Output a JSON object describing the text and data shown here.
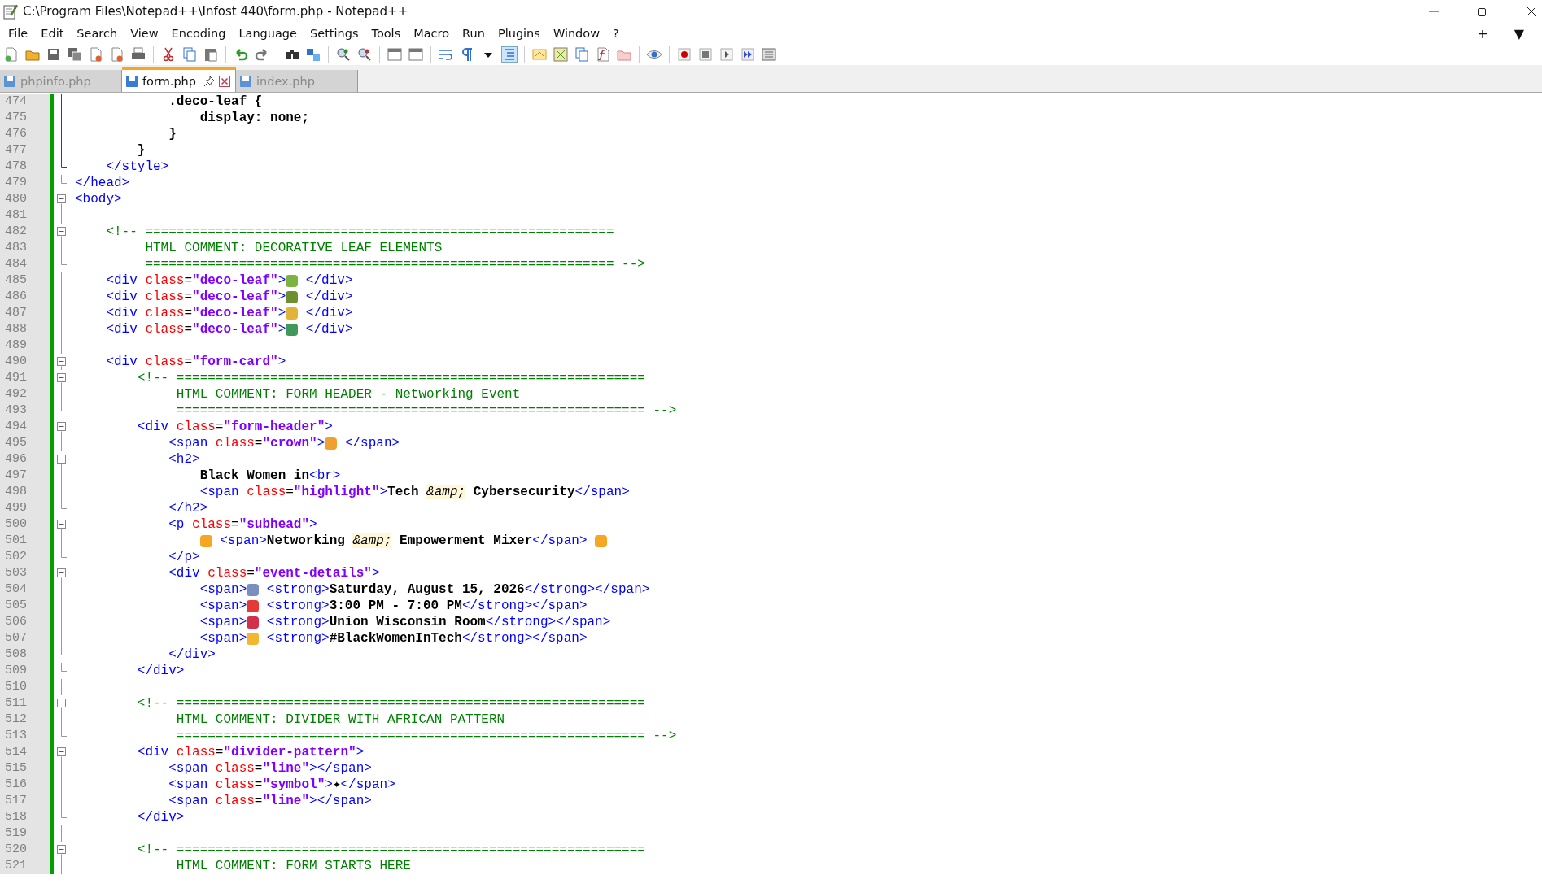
{
  "window": {
    "title": "C:\\Program Files\\Notepad++\\Infost 440\\form.php - Notepad++"
  },
  "menu": [
    "File",
    "Edit",
    "Search",
    "View",
    "Encoding",
    "Language",
    "Settings",
    "Tools",
    "Macro",
    "Run",
    "Plugins",
    "Window",
    "?"
  ],
  "menu_extras": [
    "+",
    "▼"
  ],
  "tabs": [
    {
      "label": "phpinfo.php",
      "selected": false
    },
    {
      "label": "form.php",
      "selected": true
    },
    {
      "label": "index.php",
      "selected": false
    }
  ],
  "lines": [
    {
      "n": "474",
      "fold_start": false,
      "fold_end": false,
      "current_block": true,
      "tokens": [
        {
          "kind": "text",
          "s": "            .deco-leaf {"
        }
      ]
    },
    {
      "n": "475",
      "fold_start": false,
      "fold_end": false,
      "current_block": true,
      "tokens": [
        {
          "kind": "text",
          "s": "                display: none;"
        }
      ]
    },
    {
      "n": "476",
      "fold_start": false,
      "fold_end": false,
      "current_block": true,
      "tokens": [
        {
          "kind": "text",
          "s": "            }"
        }
      ]
    },
    {
      "n": "477",
      "fold_start": false,
      "fold_end": false,
      "current_block": true,
      "tokens": [
        {
          "kind": "text",
          "s": "        }"
        }
      ]
    },
    {
      "n": "478",
      "fold_start": false,
      "fold_end": true,
      "current_block": true,
      "tokens": [
        {
          "kind": "tag",
          "s": "    </style>"
        }
      ]
    },
    {
      "n": "479",
      "fold_start": false,
      "fold_end": true,
      "current_block": false,
      "tokens": [
        {
          "kind": "tag",
          "s": "</head>"
        }
      ]
    },
    {
      "n": "480",
      "fold_start": true,
      "fold_end": false,
      "current_block": false,
      "tokens": [
        {
          "kind": "tag",
          "s": "<body>"
        }
      ]
    },
    {
      "n": "481",
      "fold_start": false,
      "fold_end": false,
      "current_block": false
    },
    {
      "n": "482",
      "fold_start": true,
      "fold_end": false,
      "current_block": false,
      "tokens": [
        {
          "kind": "comment",
          "s": "    <!-- ============================================================"
        }
      ]
    },
    {
      "n": "483",
      "fold_start": false,
      "fold_end": false,
      "current_block": false,
      "tokens": [
        {
          "kind": "comment",
          "s": "         HTML COMMENT: DECORATIVE LEAF ELEMENTS"
        }
      ]
    },
    {
      "n": "484",
      "fold_start": false,
      "fold_end": true,
      "current_block": false,
      "tokens": [
        {
          "kind": "comment",
          "s": "         ============================================================ -->"
        }
      ]
    },
    {
      "n": "485",
      "fold_start": false,
      "fold_end": false,
      "current_block": false,
      "tokens": [
        {
          "kind": "tag",
          "s": "    <div"
        },
        {
          "kind": "attr",
          "s": " class"
        },
        {
          "kind": "op",
          "s": "="
        },
        {
          "kind": "str",
          "s": "\"deco-leaf\""
        },
        {
          "kind": "tag",
          "s": ">"
        },
        {
          "kind": "emoji",
          "color": "#7cb342"
        },
        {
          "kind": "tag",
          "s": " </div>"
        }
      ]
    },
    {
      "n": "486",
      "fold_start": false,
      "fold_end": false,
      "current_block": false,
      "tokens": [
        {
          "kind": "tag",
          "s": "    <div"
        },
        {
          "kind": "attr",
          "s": " class"
        },
        {
          "kind": "op",
          "s": "="
        },
        {
          "kind": "str",
          "s": "\"deco-leaf\""
        },
        {
          "kind": "tag",
          "s": ">"
        },
        {
          "kind": "emoji",
          "color": "#6d8f2f"
        },
        {
          "kind": "tag",
          "s": " </div>"
        }
      ]
    },
    {
      "n": "487",
      "fold_start": false,
      "fold_end": false,
      "current_block": false,
      "tokens": [
        {
          "kind": "tag",
          "s": "    <div"
        },
        {
          "kind": "attr",
          "s": " class"
        },
        {
          "kind": "op",
          "s": "="
        },
        {
          "kind": "str",
          "s": "\"deco-leaf\""
        },
        {
          "kind": "tag",
          "s": ">"
        },
        {
          "kind": "emoji",
          "color": "#e0b43a"
        },
        {
          "kind": "tag",
          "s": " </div>"
        }
      ]
    },
    {
      "n": "488",
      "fold_start": false,
      "fold_end": false,
      "current_block": false,
      "tokens": [
        {
          "kind": "tag",
          "s": "    <div"
        },
        {
          "kind": "attr",
          "s": " class"
        },
        {
          "kind": "op",
          "s": "="
        },
        {
          "kind": "str",
          "s": "\"deco-leaf\""
        },
        {
          "kind": "tag",
          "s": ">"
        },
        {
          "kind": "emoji",
          "color": "#3f9a5a"
        },
        {
          "kind": "tag",
          "s": " </div>"
        }
      ]
    },
    {
      "n": "489",
      "fold_start": false,
      "fold_end": false,
      "current_block": false
    },
    {
      "n": "490",
      "fold_start": true,
      "fold_end": false,
      "current_block": false,
      "tokens": [
        {
          "kind": "tag",
          "s": "    <div"
        },
        {
          "kind": "attr",
          "s": " class"
        },
        {
          "kind": "op",
          "s": "="
        },
        {
          "kind": "str",
          "s": "\"form-card\""
        },
        {
          "kind": "tag",
          "s": ">"
        }
      ]
    },
    {
      "n": "491",
      "fold_start": true,
      "fold_end": false,
      "current_block": false,
      "tokens": [
        {
          "kind": "comment",
          "s": "        <!-- ============================================================"
        }
      ]
    },
    {
      "n": "492",
      "fold_start": false,
      "fold_end": false,
      "current_block": false,
      "tokens": [
        {
          "kind": "comment",
          "s": "             HTML COMMENT: FORM HEADER - Networking Event"
        }
      ]
    },
    {
      "n": "493",
      "fold_start": false,
      "fold_end": true,
      "current_block": false,
      "tokens": [
        {
          "kind": "comment",
          "s": "             ============================================================ -->"
        }
      ]
    },
    {
      "n": "494",
      "fold_start": true,
      "fold_end": false,
      "current_block": false,
      "tokens": [
        {
          "kind": "tag",
          "s": "        <div"
        },
        {
          "kind": "attr",
          "s": " class"
        },
        {
          "kind": "op",
          "s": "="
        },
        {
          "kind": "str",
          "s": "\"form-header\""
        },
        {
          "kind": "tag",
          "s": ">"
        }
      ]
    },
    {
      "n": "495",
      "fold_start": false,
      "fold_end": false,
      "current_block": false,
      "tokens": [
        {
          "kind": "tag",
          "s": "            <span"
        },
        {
          "kind": "attr",
          "s": " class"
        },
        {
          "kind": "op",
          "s": "="
        },
        {
          "kind": "str",
          "s": "\"crown\""
        },
        {
          "kind": "tag",
          "s": ">"
        },
        {
          "kind": "emoji",
          "color": "#f0a030"
        },
        {
          "kind": "tag",
          "s": " </span>"
        }
      ]
    },
    {
      "n": "496",
      "fold_start": true,
      "fold_end": false,
      "current_block": false,
      "tokens": [
        {
          "kind": "tag",
          "s": "            <h2>"
        }
      ]
    },
    {
      "n": "497",
      "fold_start": false,
      "fold_end": false,
      "current_block": false,
      "tokens": [
        {
          "kind": "text",
          "s": "                Black Women in"
        },
        {
          "kind": "tag",
          "s": "<br>"
        }
      ]
    },
    {
      "n": "498",
      "fold_start": false,
      "fold_end": false,
      "current_block": false,
      "tokens": [
        {
          "kind": "tag",
          "s": "                <span"
        },
        {
          "kind": "attr",
          "s": " class"
        },
        {
          "kind": "op",
          "s": "="
        },
        {
          "kind": "str",
          "s": "\"highlight\""
        },
        {
          "kind": "tag",
          "s": ">"
        },
        {
          "kind": "text",
          "s": "Tech "
        },
        {
          "kind": "entity",
          "s": "&amp;"
        },
        {
          "kind": "text",
          "s": " Cybersecurity"
        },
        {
          "kind": "tag",
          "s": "</span>"
        }
      ]
    },
    {
      "n": "499",
      "fold_start": false,
      "fold_end": true,
      "current_block": false,
      "tokens": [
        {
          "kind": "tag",
          "s": "            </h2>"
        }
      ]
    },
    {
      "n": "500",
      "fold_start": true,
      "fold_end": false,
      "current_block": false,
      "tokens": [
        {
          "kind": "tag",
          "s": "            <p"
        },
        {
          "kind": "attr",
          "s": " class"
        },
        {
          "kind": "op",
          "s": "="
        },
        {
          "kind": "str",
          "s": "\"subhead\""
        },
        {
          "kind": "tag",
          "s": ">"
        }
      ]
    },
    {
      "n": "501",
      "fold_start": false,
      "fold_end": false,
      "current_block": false,
      "tokens": [
        {
          "kind": "emoji",
          "color": "#f5a623"
        },
        {
          "kind": "tag",
          "s": " <span>"
        },
        {
          "kind": "text",
          "s": "Networking "
        },
        {
          "kind": "entity",
          "s": "&amp;"
        },
        {
          "kind": "text",
          "s": " Empowerment Mixer"
        },
        {
          "kind": "tag",
          "s": "</span> "
        },
        {
          "kind": "emoji",
          "color": "#f5a623"
        }
      ]
    },
    {
      "n": "502",
      "fold_start": false,
      "fold_end": true,
      "current_block": false,
      "tokens": [
        {
          "kind": "tag",
          "s": "            </p>"
        }
      ]
    },
    {
      "n": "503",
      "fold_start": true,
      "fold_end": false,
      "current_block": false,
      "tokens": [
        {
          "kind": "tag",
          "s": "            <div"
        },
        {
          "kind": "attr",
          "s": " class"
        },
        {
          "kind": "op",
          "s": "="
        },
        {
          "kind": "str",
          "s": "\"event-details\""
        },
        {
          "kind": "tag",
          "s": ">"
        }
      ]
    },
    {
      "n": "504",
      "fold_start": false,
      "fold_end": false,
      "current_block": false,
      "tokens": [
        {
          "kind": "tag",
          "s": "                <span>"
        },
        {
          "kind": "emoji",
          "color": "#7a8fc0"
        },
        {
          "kind": "tag",
          "s": " <strong>"
        },
        {
          "kind": "text",
          "s": "Saturday, August 15, 2026"
        },
        {
          "kind": "tag",
          "s": "</strong></span>"
        }
      ]
    },
    {
      "n": "505",
      "fold_start": false,
      "fold_end": false,
      "current_block": false,
      "tokens": [
        {
          "kind": "tag",
          "s": "                <span>"
        },
        {
          "kind": "emoji",
          "color": "#e53935"
        },
        {
          "kind": "tag",
          "s": " <strong>"
        },
        {
          "kind": "text",
          "s": "3:00 PM - 7:00 PM"
        },
        {
          "kind": "tag",
          "s": "</strong></span>"
        }
      ]
    },
    {
      "n": "506",
      "fold_start": false,
      "fold_end": false,
      "current_block": false,
      "tokens": [
        {
          "kind": "tag",
          "s": "                <span>"
        },
        {
          "kind": "emoji",
          "color": "#d32f4a"
        },
        {
          "kind": "tag",
          "s": " <strong>"
        },
        {
          "kind": "text",
          "s": "Union Wisconsin Room"
        },
        {
          "kind": "tag",
          "s": "</strong></span>"
        }
      ]
    },
    {
      "n": "507",
      "fold_start": false,
      "fold_end": false,
      "current_block": false,
      "tokens": [
        {
          "kind": "tag",
          "s": "                <span>"
        },
        {
          "kind": "emoji",
          "color": "#f2b631"
        },
        {
          "kind": "tag",
          "s": " <strong>"
        },
        {
          "kind": "text",
          "s": "#BlackWomenInTech"
        },
        {
          "kind": "tag",
          "s": "</strong></span>"
        }
      ]
    },
    {
      "n": "508",
      "fold_start": false,
      "fold_end": true,
      "current_block": false,
      "tokens": [
        {
          "kind": "tag",
          "s": "            </div>"
        }
      ]
    },
    {
      "n": "509",
      "fold_start": false,
      "fold_end": true,
      "current_block": false,
      "tokens": [
        {
          "kind": "tag",
          "s": "        </div>"
        }
      ]
    },
    {
      "n": "510",
      "fold_start": false,
      "fold_end": false,
      "current_block": false
    },
    {
      "n": "511",
      "fold_start": true,
      "fold_end": false,
      "current_block": false,
      "tokens": [
        {
          "kind": "comment",
          "s": "        <!-- ============================================================"
        }
      ]
    },
    {
      "n": "512",
      "fold_start": false,
      "fold_end": false,
      "current_block": false,
      "tokens": [
        {
          "kind": "comment",
          "s": "             HTML COMMENT: DIVIDER WITH AFRICAN PATTERN"
        }
      ]
    },
    {
      "n": "513",
      "fold_start": false,
      "fold_end": true,
      "current_block": false,
      "tokens": [
        {
          "kind": "comment",
          "s": "             ============================================================ -->"
        }
      ]
    },
    {
      "n": "514",
      "fold_start": true,
      "fold_end": false,
      "current_block": false,
      "tokens": [
        {
          "kind": "tag",
          "s": "        <div"
        },
        {
          "kind": "attr",
          "s": " class"
        },
        {
          "kind": "op",
          "s": "="
        },
        {
          "kind": "str",
          "s": "\"divider-pattern\""
        },
        {
          "kind": "tag",
          "s": ">"
        }
      ]
    },
    {
      "n": "515",
      "fold_start": false,
      "fold_end": false,
      "current_block": false,
      "tokens": [
        {
          "kind": "tag",
          "s": "            <span"
        },
        {
          "kind": "attr",
          "s": " class"
        },
        {
          "kind": "op",
          "s": "="
        },
        {
          "kind": "str",
          "s": "\"line\""
        },
        {
          "kind": "tag",
          "s": "></span>"
        }
      ]
    },
    {
      "n": "516",
      "fold_start": false,
      "fold_end": false,
      "current_block": false,
      "tokens": [
        {
          "kind": "tag",
          "s": "            <span"
        },
        {
          "kind": "attr",
          "s": " class"
        },
        {
          "kind": "op",
          "s": "="
        },
        {
          "kind": "str",
          "s": "\"symbol\""
        },
        {
          "kind": "tag",
          "s": ">"
        },
        {
          "kind": "text",
          "s": "✦"
        },
        {
          "kind": "tag",
          "s": "</span>"
        }
      ]
    },
    {
      "n": "517",
      "fold_start": false,
      "fold_end": false,
      "current_block": false,
      "tokens": [
        {
          "kind": "tag",
          "s": "            <span"
        },
        {
          "kind": "attr",
          "s": " class"
        },
        {
          "kind": "op",
          "s": "="
        },
        {
          "kind": "str",
          "s": "\"line\""
        },
        {
          "kind": "tag",
          "s": "></span>"
        }
      ]
    },
    {
      "n": "518",
      "fold_start": false,
      "fold_end": true,
      "current_block": false,
      "tokens": [
        {
          "kind": "tag",
          "s": "        </div>"
        }
      ]
    },
    {
      "n": "519",
      "fold_start": false,
      "fold_end": false,
      "current_block": false
    },
    {
      "n": "520",
      "fold_start": true,
      "fold_end": false,
      "current_block": false,
      "tokens": [
        {
          "kind": "comment",
          "s": "        <!-- ============================================================"
        }
      ]
    },
    {
      "n": "521",
      "fold_start": false,
      "fold_end": false,
      "current_block": false,
      "tokens": [
        {
          "kind": "comment",
          "s": "             HTML COMMENT: FORM STARTS HERE"
        }
      ]
    }
  ]
}
